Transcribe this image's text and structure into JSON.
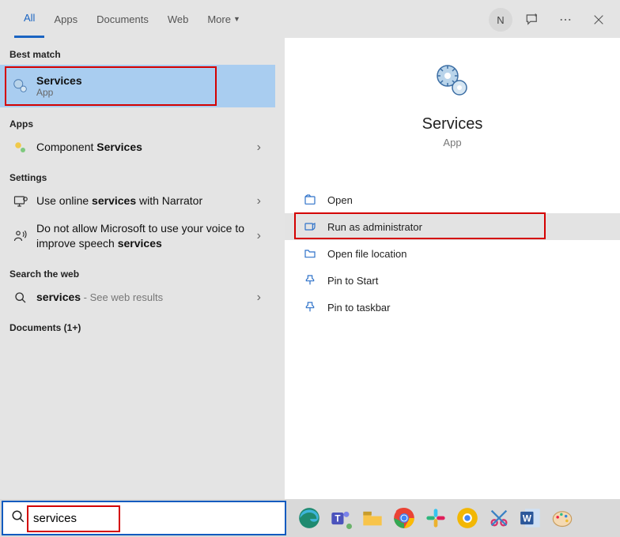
{
  "tabs": {
    "all": "All",
    "apps": "Apps",
    "documents": "Documents",
    "web": "Web",
    "more": "More"
  },
  "top_right": {
    "avatar_letter": "N"
  },
  "left": {
    "best_match_header": "Best match",
    "best_match": {
      "title": "Services",
      "subtitle": "App"
    },
    "apps_header": "Apps",
    "apps": {
      "component_services_prefix": "Component ",
      "component_services_bold": "Services"
    },
    "settings_header": "Settings",
    "setting1_pre": "Use online ",
    "setting1_bold": "services",
    "setting1_post": " with Narrator",
    "setting2_pre": "Do not allow Microsoft to use your voice to improve speech ",
    "setting2_bold": "services",
    "web_header": "Search the web",
    "web_bold": "services",
    "web_post": " - See web results",
    "docs_header": "Documents (1+)"
  },
  "detail": {
    "title": "Services",
    "subtitle": "App",
    "actions": {
      "open": "Open",
      "run_admin": "Run as administrator",
      "open_loc": "Open file location",
      "pin_start": "Pin to Start",
      "pin_taskbar": "Pin to taskbar"
    }
  },
  "search": {
    "value": "services"
  }
}
